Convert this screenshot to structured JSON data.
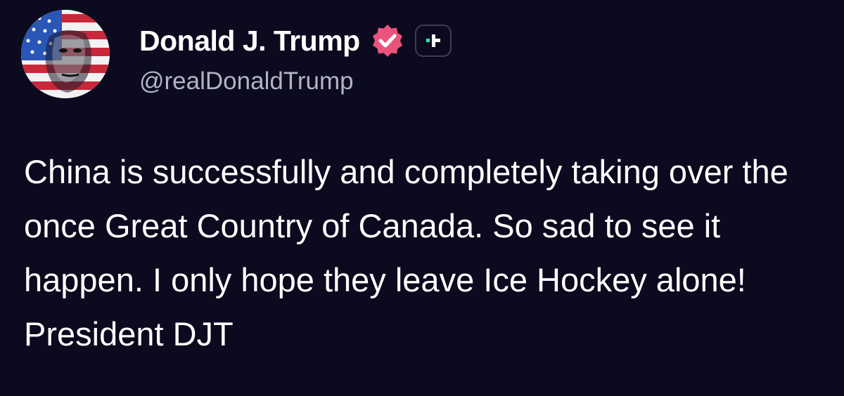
{
  "author": {
    "display_name": "Donald J. Trump",
    "handle": "@realDonaldTrump",
    "avatar_icon": "flag-portrait-avatar",
    "verified_icon": "verified-badge-icon",
    "plus_icon": "truth-plus-badge-icon"
  },
  "post": {
    "text": "China is successfully and completely taking over the once Great Country of Canada. So sad to see it happen. I only hope they leave Ice Hockey alone! President DJT"
  },
  "colors": {
    "background": "#0b0a1f",
    "verified": "#e9537c",
    "plus_accent": "#2ee6a6",
    "handle": "#b3b3c4"
  }
}
